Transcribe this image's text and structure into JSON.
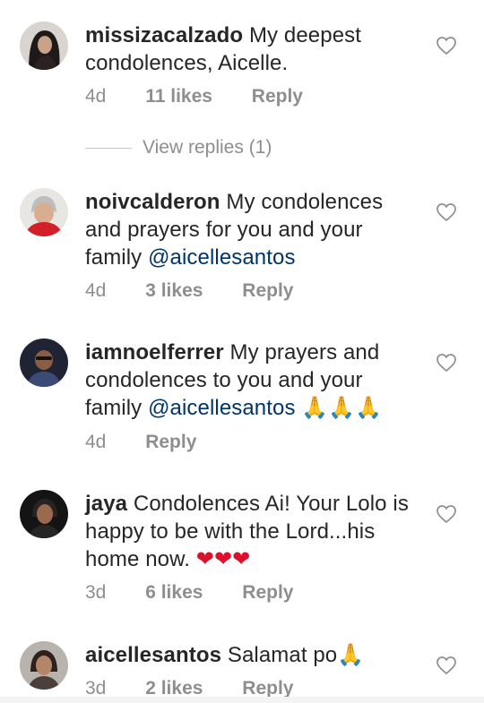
{
  "comments": [
    {
      "username": "missizacalzado",
      "text": "My deepest condolences, Aicelle.",
      "mention": "",
      "emoji": "",
      "time": "4d",
      "likes": "11 likes",
      "reply": "Reply",
      "avatar_icon": "user-avatar-icon"
    },
    {
      "username": "noivcalderon",
      "text": "My condolences and prayers for you and your family",
      "mention": "@aicellesantos",
      "emoji": "",
      "time": "4d",
      "likes": "3 likes",
      "reply": "Reply",
      "avatar_icon": "user-avatar-icon"
    },
    {
      "username": "iamnoelferrer",
      "text": "My prayers and condolences to you and your family",
      "mention": "@aicellesantos",
      "emoji": "🙏🙏🙏",
      "time": "4d",
      "likes": "",
      "reply": "Reply",
      "avatar_icon": "user-avatar-icon"
    },
    {
      "username": "jaya",
      "text": "Condolences Ai! Your Lolo is happy to be with the Lord...his home now.",
      "mention": "",
      "emoji": "❤❤❤",
      "time": "3d",
      "likes": "6 likes",
      "reply": "Reply",
      "avatar_icon": "user-avatar-icon"
    },
    {
      "username": "aicellesantos",
      "text": "Salamat po",
      "mention": "",
      "emoji": "🙏",
      "time": "3d",
      "likes": "2 likes",
      "reply": "Reply",
      "avatar_icon": "user-avatar-icon"
    }
  ],
  "view_replies": "View replies (1)",
  "colors": {
    "username": "#262626",
    "secondary": "#8e8e8e",
    "mention": "#003569",
    "divider": "#c7c7c7"
  },
  "icons": {
    "like": "heart-outline-icon"
  }
}
